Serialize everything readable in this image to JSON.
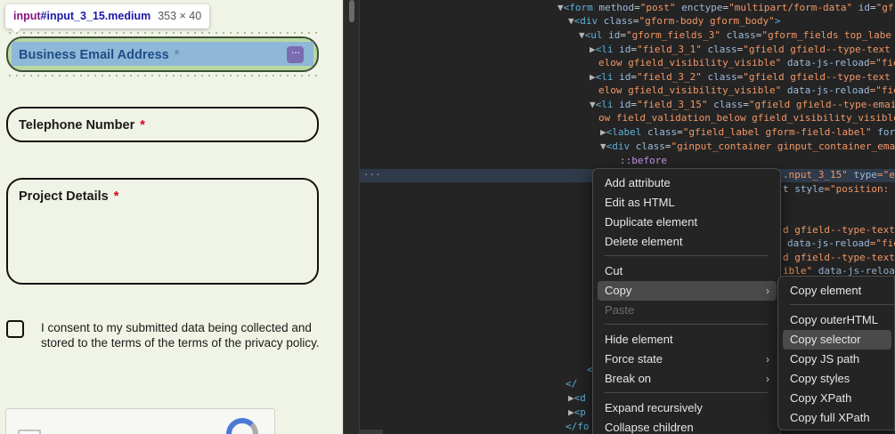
{
  "tooltip": {
    "tag": "input",
    "id": "#input_3_15.medium",
    "size": "353 × 40"
  },
  "form": {
    "email_label": "Business Email Address",
    "phone_label": "Telephone Number",
    "project_label": "Project Details",
    "required_mark": "*",
    "consent_text": "I consent to my submitted data being collected and stored to the terms of the terms of the privacy policy.",
    "kebab": "···"
  },
  "devtools": {
    "ellipsis": "···",
    "lines": [
      {
        "l1_tag": "<form",
        "l1_a1": " method",
        "l1_v1": "\"post\"",
        "l1_a2": " enctype",
        "l1_v2": "\"multipart/form-data\"",
        "l1_a3": " id",
        "l1_v3": "\"gf"
      },
      {
        "l2_tag": "<div",
        "l2_a1": " class",
        "l2_v1": "\"gform-body gform_body\"",
        "l2_end": ">"
      },
      {
        "l3_tag": "<ul",
        "l3_a1": " id",
        "l3_v1": "\"gform_fields_3\"",
        "l3_a2": " class",
        "l3_v2": "\"gform_fields top_labe"
      }
    ],
    "f1a": {
      "tag": "<li",
      "a1": " id",
      "v1": "\"field_3_1\"",
      "a2": " class",
      "v2": "\"gfield gfield--type-text"
    },
    "f1b": {
      "v": "elow gfield_visibility_visible\"",
      "a": " data-js-reload",
      "v2": "=\"fie"
    },
    "f2a": {
      "tag": "<li",
      "a1": " id",
      "v1": "\"field_3_2\"",
      "a2": " class",
      "v2": "\"gfield gfield--type-text"
    },
    "f2b": {
      "v": "elow gfield_visibility_visible\"",
      "a": " data-js-reload",
      "v2": "=\"fie"
    },
    "f3a": {
      "tag": "<li",
      "a1": " id",
      "v1": "\"field_3_15\"",
      "a2": " class",
      "v2": "\"gfield gfield--type-emai"
    },
    "f3b": {
      "v": "ow field_validation_below gfield_visibility_visible"
    },
    "lab": {
      "tag": "<label",
      "a1": " class",
      "v1": "\"gfield_label gform-field-label\"",
      "a2": " for"
    },
    "div": {
      "tag": "<div",
      "a1": " class",
      "v1": "\"ginput_container ginput_container_ema"
    },
    "before": "::before",
    "sel": {
      "v": "nput_3_15\"",
      "a": " type",
      "v2": "=\"em"
    },
    "sel2": {
      "t": "t",
      "a": " style",
      "v": "=\"position: r"
    },
    "r1": {
      "v": "d gfield--type-text"
    },
    "r2": {
      "a": "data-js-reload",
      "v": "=\"fie"
    },
    "r3": {
      "v": "d gfield--type-texta"
    },
    "r4": {
      "v": "ible\"",
      "a": " data-js-reload"
    },
    "bot1": "<",
    "bot2": "</",
    "bot3": "<d",
    "bot4": "<p",
    "bot5": "</fo"
  },
  "context_menu": {
    "items": [
      "Add attribute",
      "Edit as HTML",
      "Duplicate element",
      "Delete element",
      "Cut",
      "Copy",
      "Paste",
      "Hide element",
      "Force state",
      "Break on",
      "Expand recursively",
      "Collapse children"
    ],
    "submenu_arrow": "›"
  },
  "copy_submenu": {
    "items": [
      "Copy element",
      "Copy outerHTML",
      "Copy selector",
      "Copy JS path",
      "Copy styles",
      "Copy XPath",
      "Copy full XPath"
    ],
    "highlighted": "Copy selector"
  },
  "colors": {
    "page_bg": "#f0f4e6",
    "devtools_bg": "#242424",
    "tag": "#5db0d7",
    "attr": "#9bbbdc",
    "value": "#f29766"
  }
}
